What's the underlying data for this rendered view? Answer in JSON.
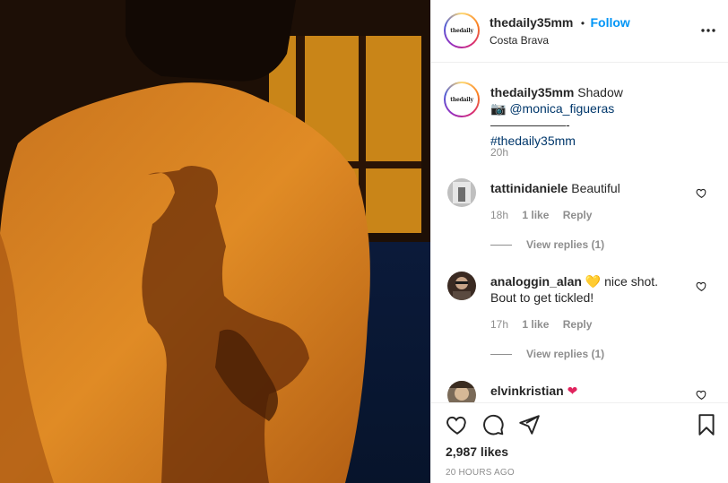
{
  "post": {
    "author": "thedaily35mm",
    "follow_separator": "•",
    "follow_label": "Follow",
    "location": "Costa Brava",
    "avatar_text": "thedaily"
  },
  "caption": {
    "author": "thedaily35mm",
    "text": "Shadow",
    "camera_emoji": "📷",
    "mention": "@monica_figueras",
    "dash": "——————-",
    "hashtag": "#thedaily35mm",
    "time": "20h"
  },
  "comments": [
    {
      "author": "tattinidaniele",
      "text": "Beautiful",
      "time": "18h",
      "likes": "1 like",
      "reply": "Reply",
      "view_replies": "View replies (1)"
    },
    {
      "author": "analoggin_alan",
      "emoji": "💛",
      "text": "nice shot.",
      "text2": "Bout to get tickled!",
      "time": "17h",
      "likes": "1 like",
      "reply": "Reply",
      "view_replies": "View replies (1)"
    },
    {
      "author": "elvinkristian",
      "emoji": "❤"
    }
  ],
  "footer": {
    "likes": "2,987 likes",
    "ago": "20 HOURS AGO"
  },
  "colors": {
    "link_blue": "#0095f6",
    "hashtag_blue": "#00376b",
    "muted": "#8e8e8e",
    "heart_yellow": "#f5d000",
    "heart_red": "#e0245e"
  },
  "icons": [
    "more-icon",
    "heart-icon",
    "comment-icon",
    "share-icon",
    "bookmark-icon",
    "small-heart-icon"
  ]
}
